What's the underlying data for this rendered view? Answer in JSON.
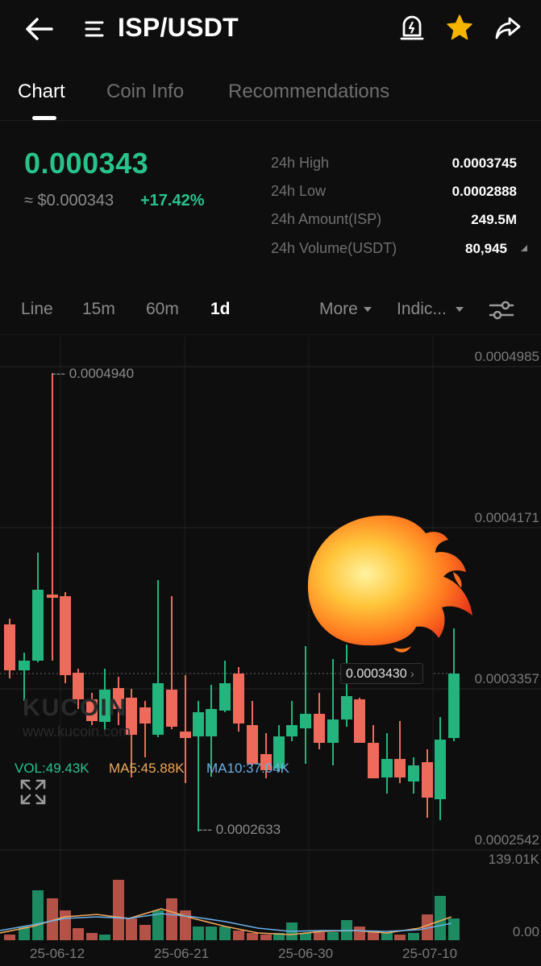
{
  "header": {
    "back_icon": "arrow-left-icon",
    "menu_icon": "menu-icon",
    "pair": "ISP/USDT",
    "alert_icon": "price-alert-icon",
    "favorite_icon": "star-icon",
    "share_icon": "share-icon"
  },
  "tabs": [
    {
      "label": "Chart",
      "active": true
    },
    {
      "label": "Coin Info",
      "active": false
    },
    {
      "label": "Recommendations",
      "active": false
    }
  ],
  "ticker": {
    "price": "0.000343",
    "fiat": "≈ $0.000343",
    "change": "+17.42%",
    "stats": [
      {
        "label": "24h High",
        "value": "0.0003745"
      },
      {
        "label": "24h Low",
        "value": "0.0002888"
      },
      {
        "label": "24h Amount(ISP)",
        "value": "249.5M"
      },
      {
        "label": "24h Volume(USDT)",
        "value": "80,945"
      }
    ]
  },
  "timeframes": {
    "items": [
      {
        "label": "Line",
        "active": false
      },
      {
        "label": "15m",
        "active": false
      },
      {
        "label": "60m",
        "active": false
      },
      {
        "label": "1d",
        "active": true
      }
    ],
    "more": "More",
    "indicators": "Indic...",
    "settings_icon": "sliders-icon"
  },
  "chart": {
    "y_axis": [
      "0.0004985",
      "0.0004171",
      "0.0003357",
      "0.0002542"
    ],
    "high_marker": "0.0004940",
    "low_marker": "0.0002633",
    "last_price": "0.0003430",
    "vol_axis": [
      "139.01K",
      "0.00"
    ],
    "vol_legend": {
      "vol": "VOL:49.43K",
      "ma5": "MA5:45.88K",
      "ma10": "MA10:37.04K"
    },
    "dates": [
      "25-06-12",
      "25-06-21",
      "25-06-30",
      "25-07-10"
    ],
    "watermark_logo": "KUCOIN",
    "watermark_url": "www.kucoin.com",
    "fullscreen_icon": "fullscreen-icon",
    "overlay_icon": "fire-emoji-icon",
    "colors": {
      "up": "#24b47e",
      "down": "#ee6a5b",
      "ma5": "#f0a75a",
      "ma10": "#6ab0e8"
    }
  }
}
